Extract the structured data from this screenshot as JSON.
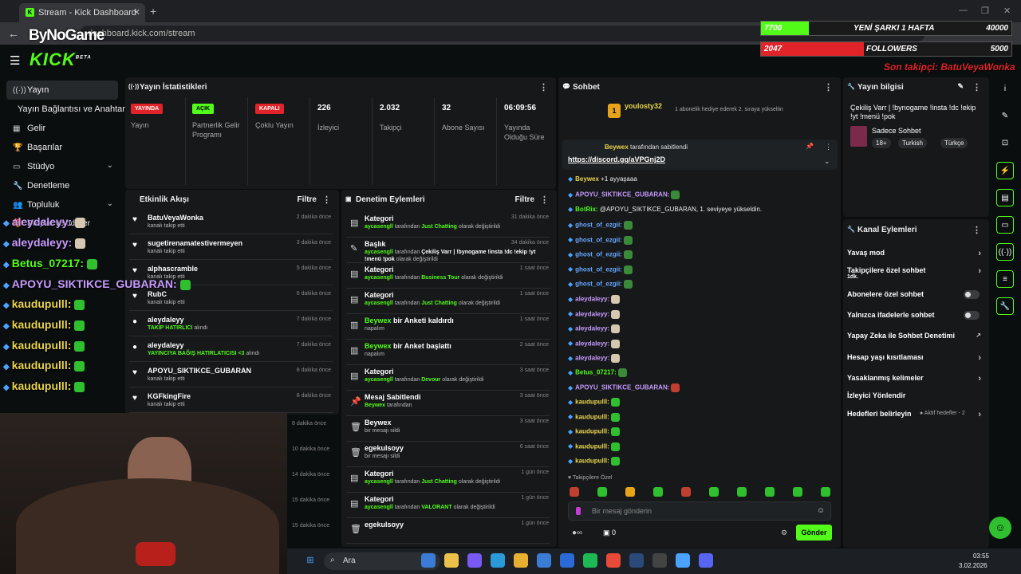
{
  "browser": {
    "tab_title": "Stream - Kick Dashboard",
    "url": "dashboard.kick.com/stream"
  },
  "watermark": "ByNoGame",
  "sidebar": {
    "items": [
      {
        "label": "Yayın",
        "icon": "broadcast-icon"
      },
      {
        "label": "Yayın Bağlantısı ve Anahtarı",
        "icon": ""
      },
      {
        "label": "Gelir",
        "icon": "revenue-icon"
      },
      {
        "label": "Başarılar",
        "icon": "trophy-icon"
      },
      {
        "label": "Stüdyo",
        "icon": "studio-icon"
      },
      {
        "label": "Denetleme",
        "icon": "wrench-icon"
      },
      {
        "label": "Topluluk",
        "icon": "community-icon"
      },
      {
        "label": "Droplar ve ödüller",
        "icon": ""
      }
    ]
  },
  "stats": {
    "title": "Yayın İstatistikleri",
    "items": [
      {
        "badge": "YAYINDA",
        "badge_color": "#e0242a",
        "label": "Yayın"
      },
      {
        "badge": "AÇIK",
        "badge_color": "#53fc18",
        "label": "Partnerlik Gelir Programı"
      },
      {
        "badge": "KAPALI",
        "badge_color": "#e0242a",
        "label": "Çoklu Yayın"
      },
      {
        "value": "226",
        "label": "İzleyici"
      },
      {
        "value": "2.032",
        "label": "Takipçi"
      },
      {
        "value": "32",
        "label": "Abone Sayısı"
      },
      {
        "value": "06:09:56",
        "label": "Yayında Olduğu Süre"
      }
    ]
  },
  "activity": {
    "title": "Etkinlik Akışı",
    "filter": "Filtre",
    "rows": [
      {
        "name": "BatuVeyaWonka",
        "sub": "kanalı takip etti",
        "time": "2 dakika önce"
      },
      {
        "name": "sugetirenamatestivermeyen",
        "sub": "kanalı takip etti",
        "time": "3 dakika önce"
      },
      {
        "name": "alphascramble",
        "sub": "kanalı takip etti",
        "time": "5 dakika önce"
      },
      {
        "name": "RubC",
        "sub": "kanalı takip etti",
        "time": "6 dakika önce"
      },
      {
        "name": "aleydaleyy",
        "sub": "TAKİP HATIRLICI",
        "sub2": "alındı",
        "time": "7 dakika önce"
      },
      {
        "name": "aleydaleyy",
        "sub": "YAYINCIYA BAĞIŞ HATIRLATICISI &lt;3",
        "sub2": "alındı",
        "time": "7 dakika önce"
      },
      {
        "name": "APOYU_SIKTIKCE_GUBARAN",
        "sub": "kanalı takip etti",
        "time": "8 dakika önce"
      },
      {
        "name": "KGFkingFire",
        "sub": "kanalı takip etti",
        "time": "8 dakika önce"
      }
    ],
    "extra_times": [
      "8 dakika önce",
      "10 dakika önce",
      "14 dakika önce",
      "15 dakika önce",
      "15 dakika önce"
    ]
  },
  "moderation": {
    "title": "Denetim Eylemleri",
    "filter": "Filtre",
    "rows": [
      {
        "icon": "category-icon",
        "title": "Kategori",
        "actor": "aycasengll",
        "mid": "tarafından",
        "val": "Just Chatting",
        "end": "olarak değiştirildi",
        "time": "31 dakika önce"
      },
      {
        "icon": "title-icon",
        "title": "Başlık",
        "actor": "aycasengll",
        "mid": "tarafından",
        "val": "Çekiliş Varr | !bynogame !insta !dc !ekip !yt !menü !pok",
        "end": "olarak değiştirildi",
        "time": "34 dakika önce"
      },
      {
        "icon": "category-icon",
        "title": "Kategori",
        "actor": "aycasengll",
        "mid": "tarafından",
        "val": "Business Tour",
        "end": "olarak değiştirildi",
        "time": "1 saat önce"
      },
      {
        "icon": "category-icon",
        "title": "Kategori",
        "actor": "aycasengll",
        "mid": "tarafından",
        "val": "Just Chatting",
        "end": "olarak değiştirildi",
        "time": "1 saat önce"
      },
      {
        "icon": "poll-icon",
        "title": "Beywex bir Anketi kaldırdı",
        "sub": "napalım",
        "time": "1 saat önce"
      },
      {
        "icon": "poll-icon",
        "title": "Beywex bir Anket başlattı",
        "sub": "napalım",
        "time": "2 saat önce"
      },
      {
        "icon": "category-icon",
        "title": "Kategori",
        "actor": "aycasengll",
        "mid": "tarafından",
        "val": "Devour",
        "end": "olarak değiştirildi",
        "time": "3 saat önce"
      },
      {
        "icon": "pin-icon",
        "title": "Mesaj Sabitlendi",
        "actor": "Beywex",
        "mid": "tarafından",
        "time": "3 saat önce"
      },
      {
        "icon": "trash-icon",
        "title": "Beywex",
        "sub": "bir mesajı sildi",
        "time": "3 saat önce"
      },
      {
        "icon": "trash-icon",
        "title": "egekulsoyy",
        "sub": "bir mesajı sildi",
        "time": "6 saat önce"
      },
      {
        "icon": "category-icon",
        "title": "Kategori",
        "actor": "aycasengll",
        "mid": "tarafından",
        "val": "Just Chatting",
        "end": "olarak değiştirildi",
        "time": "1 gün önce"
      },
      {
        "icon": "category-icon",
        "title": "Kategori",
        "actor": "aycasengll",
        "mid": "tarafından",
        "val": "VALORANT",
        "end": "olarak değiştirildi",
        "time": "1 gün önce"
      },
      {
        "icon": "trash-icon",
        "title": "egekulsoyy",
        "sub": "",
        "time": "1 gün önce"
      }
    ]
  },
  "chat": {
    "title": "Sohbet",
    "gift_user": "youlosty32",
    "gift_text": "1 abonelik hediye ederek 2. sıraya yükseltin",
    "pinned_by": "Beywex",
    "pinned_suffix": "tarafından sabitlendi",
    "pinned_link": "https://discord.gg/aVPGnj2D",
    "messages": [
      {
        "user": "Beywex",
        "text": "+1 ayyaşaaa",
        "color": "#e8d44d"
      },
      {
        "user": "APOYU_SIKTIKCE_GUBARAN:",
        "text": "",
        "color": "#c89bff"
      },
      {
        "user": "BotRix:",
        "text": "@APOYU_SIKTIKCE_GUBARAN, 1. seviyeye yükseldin.",
        "color": "#53fc18"
      },
      {
        "user": "ghost_of_ezgii:",
        "text": "",
        "color": "#6aa9ff"
      },
      {
        "user": "ghost_of_ezgii:",
        "text": "",
        "color": "#6aa9ff"
      },
      {
        "user": "ghost_of_ezgii:",
        "text": "",
        "color": "#6aa9ff"
      },
      {
        "user": "ghost_of_ezgii:",
        "text": "",
        "color": "#6aa9ff"
      },
      {
        "user": "ghost_of_ezgii:",
        "text": "",
        "color": "#6aa9ff"
      },
      {
        "user": "aleydaleyy:",
        "text": "",
        "color": "#c89bff"
      },
      {
        "user": "aleydaleyy:",
        "text": "",
        "color": "#c89bff"
      },
      {
        "user": "aleydaleyy:",
        "text": "",
        "color": "#c89bff"
      },
      {
        "user": "aleydaleyy:",
        "text": "",
        "color": "#c89bff"
      },
      {
        "user": "aleydaleyy:",
        "text": "",
        "color": "#c89bff"
      },
      {
        "user": "Betus_07217:",
        "text": "",
        "color": "#53fc18"
      },
      {
        "user": "APOYU_SIKTIKCE_GUBARAN:",
        "text": "",
        "color": "#c89bff"
      },
      {
        "user": "kaudupulll:",
        "text": "",
        "color": "#e8d44d"
      },
      {
        "user": "kaudupulll:",
        "text": "",
        "color": "#e8d44d"
      },
      {
        "user": "kaudupulll:",
        "text": "",
        "color": "#e8d44d"
      },
      {
        "user": "kaudupulll:",
        "text": "",
        "color": "#e8d44d"
      },
      {
        "user": "kaudupulll:",
        "text": "",
        "color": "#e8d44d"
      }
    ],
    "followers_only": "Takipçilere Özel",
    "input_placeholder": "Bir mesaj gönderin",
    "points": "0",
    "send": "Gönder"
  },
  "stream_info": {
    "title": "Yayın bilgisi",
    "stream_title": "Çekiliş Varr | !bynogame !insta !dc !ekip !yt !menü !pok",
    "category": "Sadece Sohbet",
    "tags": [
      "18+",
      "Turkish",
      "Türkçe"
    ]
  },
  "channel_actions": {
    "title": "Kanal Eylemleri",
    "rows": [
      {
        "label": "Yavaş mod",
        "type": "chevron"
      },
      {
        "label": "Takipçilere özel sohbet",
        "sub": "1dk.",
        "type": "chevron"
      },
      {
        "label": "Abonelere özel sohbet",
        "type": "toggle"
      },
      {
        "label": "Yalnızca ifadelerle sohbet",
        "type": "toggle"
      },
      {
        "label": "Yapay Zeka ile Sohbet Denetimi",
        "type": "external"
      },
      {
        "label": "Hesap yaşı kısıtlaması",
        "type": "chevron"
      },
      {
        "label": "Yasaklanmış kelimeler",
        "type": "chevron"
      },
      {
        "label": "İzleyici Yönlendir",
        "type": "none"
      },
      {
        "label": "Hedefleri belirleyin",
        "sub": "Aktif hedefler - 2",
        "type": "chevron"
      }
    ]
  },
  "overlay": {
    "goal1_left": "7700",
    "goal1_label": "YENİ ŞARKI 1 HAFTA",
    "goal1_right": "40000",
    "goal1_progress": 0.19,
    "goal2_left": "2047",
    "goal2_label": "FOLLOWERS",
    "goal2_right": "5000",
    "goal2_progress": 0.41,
    "last_follow": "Son takipçi: BatuVeyaWonka",
    "chat": [
      {
        "user": "aleydaleyy",
        "color": "p"
      },
      {
        "user": "aleydaleyy",
        "color": "p"
      },
      {
        "user": "Betus_07217",
        "color": "g"
      },
      {
        "user": "APOYU_SIKTIKCE_GUBARAN",
        "color": "p"
      },
      {
        "user": "kaudupulll",
        "color": "y"
      },
      {
        "user": "kaudupulll",
        "color": "y"
      },
      {
        "user": "kaudupulll",
        "color": "y"
      },
      {
        "user": "kaudupulll",
        "color": "y"
      },
      {
        "user": "kaudupulll",
        "color": "y"
      }
    ]
  },
  "taskbar": {
    "search": "Ara",
    "time": "03:55",
    "date": "3.02.2026"
  }
}
